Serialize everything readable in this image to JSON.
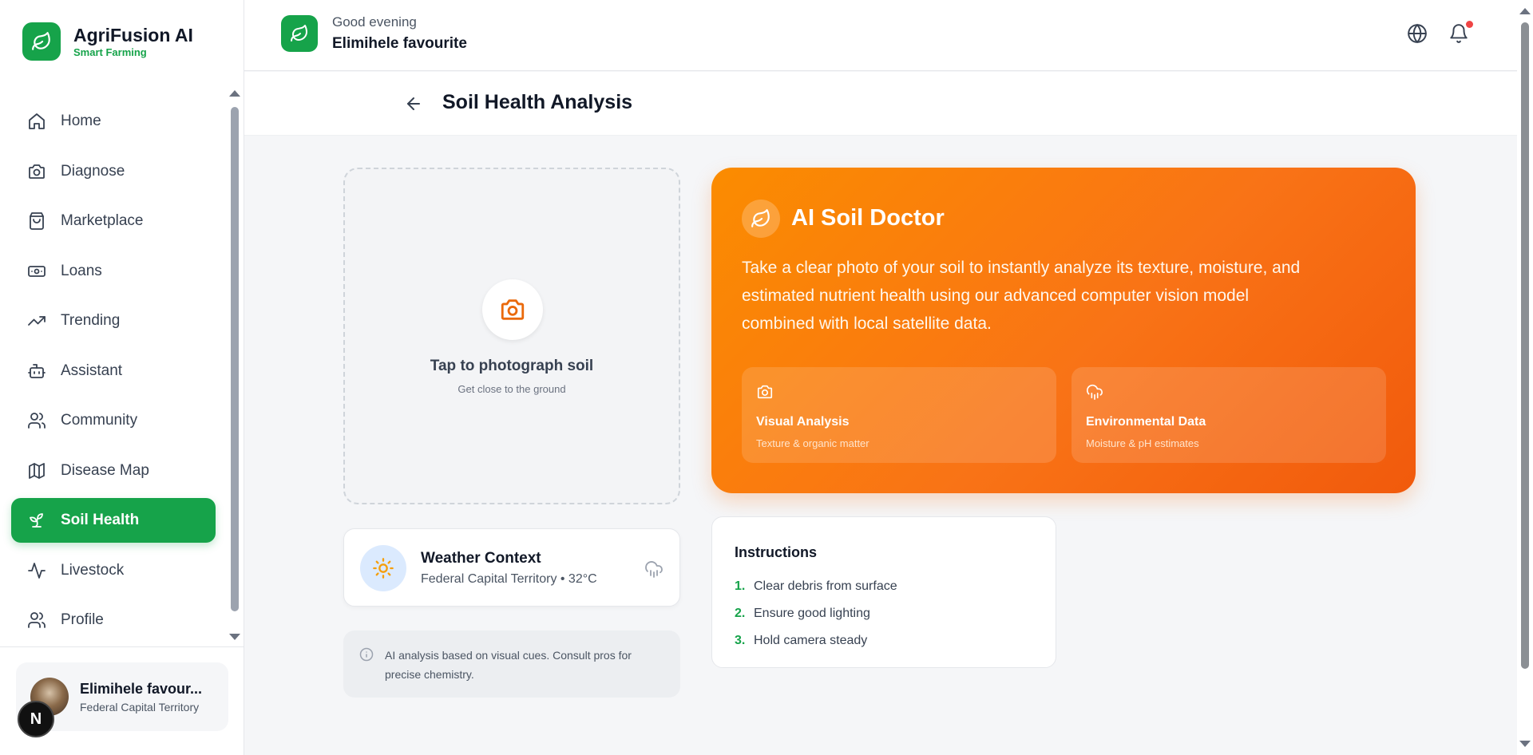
{
  "brand": {
    "name": "AgriFusion AI",
    "subtitle": "Smart Farming"
  },
  "header": {
    "greeting": "Good evening",
    "user_name": "Elimihele favourite"
  },
  "sidebar": {
    "items": [
      {
        "label": "Home",
        "icon": "home-icon"
      },
      {
        "label": "Diagnose",
        "icon": "camera-icon"
      },
      {
        "label": "Marketplace",
        "icon": "shopping-bag-icon"
      },
      {
        "label": "Loans",
        "icon": "banknote-icon"
      },
      {
        "label": "Trending",
        "icon": "trending-up-icon"
      },
      {
        "label": "Assistant",
        "icon": "bot-icon"
      },
      {
        "label": "Community",
        "icon": "users-icon"
      },
      {
        "label": "Disease Map",
        "icon": "map-icon"
      },
      {
        "label": "Soil Health",
        "icon": "sprout-icon",
        "active": true
      },
      {
        "label": "Livestock",
        "icon": "activity-icon"
      },
      {
        "label": "Profile",
        "icon": "user-icon"
      }
    ],
    "user": {
      "name": "Elimihele favour...",
      "location": "Federal Capital Territory"
    },
    "badge": "N"
  },
  "page": {
    "title": "Soil Health Analysis"
  },
  "upload": {
    "title": "Tap to photograph soil",
    "subtitle": "Get close to the ground"
  },
  "weather": {
    "title": "Weather Context",
    "subtitle": "Federal Capital Territory • 32°C"
  },
  "disclaimer": {
    "text": "AI analysis based on visual cues. Consult pros for precise chemistry."
  },
  "doctor": {
    "title": "AI Soil Doctor",
    "description": "Take a clear photo of your soil to instantly analyze its texture, moisture, and estimated nutrient health using our advanced computer vision model combined with local satellite data.",
    "features": [
      {
        "title": "Visual Analysis",
        "subtitle": "Texture & organic matter"
      },
      {
        "title": "Environmental Data",
        "subtitle": "Moisture & pH estimates"
      }
    ]
  },
  "instructions": {
    "title": "Instructions",
    "steps": [
      {
        "num": "1.",
        "text": "Clear debris from surface"
      },
      {
        "num": "2.",
        "text": "Ensure good lighting"
      },
      {
        "num": "3.",
        "text": "Hold camera steady"
      }
    ]
  },
  "colors": {
    "brand": "#16a34a",
    "accent": "#f97316",
    "notification": "#ef4444"
  }
}
